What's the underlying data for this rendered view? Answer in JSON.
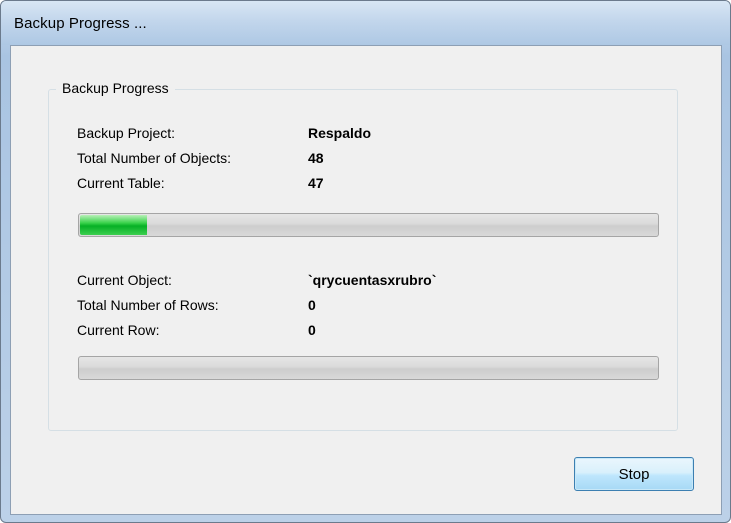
{
  "window": {
    "title": "Backup Progress ..."
  },
  "group": {
    "title": "Backup Progress"
  },
  "project_info": {
    "backup_project_label": "Backup Project:",
    "backup_project_value": "Respaldo",
    "total_objects_label": "Total Number of Objects:",
    "total_objects_value": "48",
    "current_table_label": "Current Table:",
    "current_table_value": "47",
    "tables_progress_percent": 12
  },
  "object_info": {
    "current_object_label": "Current Object:",
    "current_object_value": "`qrycuentasxrubro`",
    "total_rows_label": "Total Number of Rows:",
    "total_rows_value": "0",
    "current_row_label": "Current Row:",
    "current_row_value": "0",
    "rows_progress_percent": 0
  },
  "buttons": {
    "stop_label": "Stop"
  },
  "colors": {
    "progress_fill": "#06b025",
    "titlebar": "#bcd2ea",
    "client_bg": "#f0f0f0"
  }
}
